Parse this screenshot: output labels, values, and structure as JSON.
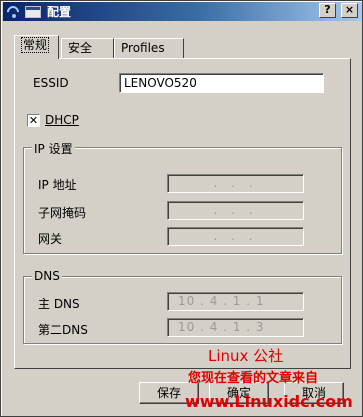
{
  "window": {
    "title": "配置"
  },
  "titlebar_buttons": {
    "help": "?",
    "close": "×"
  },
  "tabs": [
    {
      "label": "常规",
      "active": true
    },
    {
      "label": "安全",
      "active": false
    },
    {
      "label": "Profiles",
      "active": false
    }
  ],
  "general": {
    "essid_label": "ESSID",
    "essid_value": "LENOVO520",
    "dhcp_label": "DHCP",
    "dhcp_checked": "✕",
    "ip_group": {
      "title": "IP 设置",
      "ip_label": "IP 地址",
      "ip_value": ". . .",
      "mask_label": "子网掩码",
      "mask_value": ". . .",
      "gateway_label": "网关",
      "gateway_value": ". . ."
    },
    "dns_group": {
      "title": "DNS",
      "primary_label": "主 DNS",
      "primary_value": "10 . 4 . 1 . 1",
      "secondary_label": "第二DNS",
      "secondary_value": "10 . 4 . 1 . 3"
    }
  },
  "buttons": {
    "save": "保存",
    "ok": "确定",
    "cancel": "取消"
  },
  "watermark": {
    "line1": "Linux 公社",
    "line2": "您现在查看的文章来自",
    "line3": "www.Linuxidc.com"
  }
}
